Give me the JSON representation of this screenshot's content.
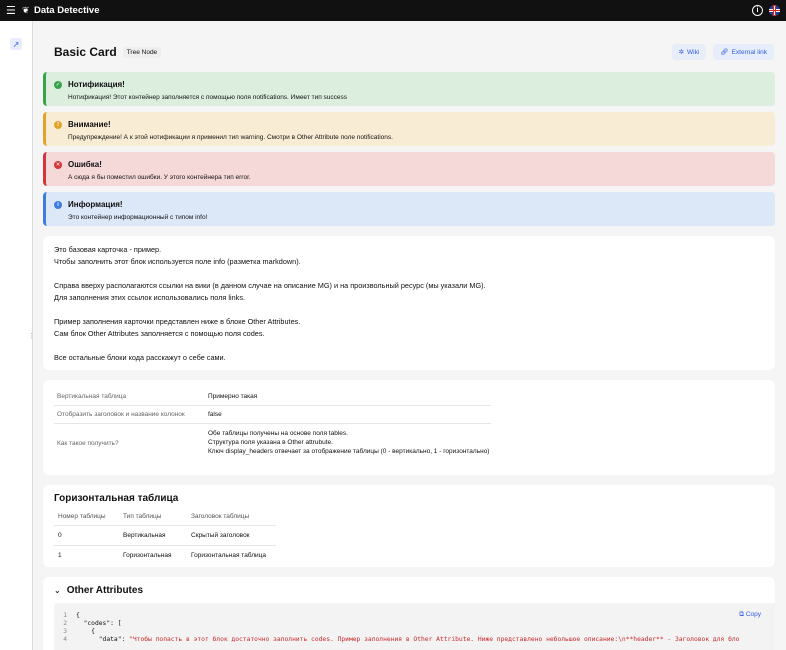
{
  "topbar": {
    "title": "Data Detective"
  },
  "header": {
    "title": "Basic Card",
    "tag": "Tree Node",
    "wiki_label": "Wiki",
    "external_label": "External link"
  },
  "alerts": [
    {
      "title": "Нотификация!",
      "body": "Нотификация! Этот контейнер заполняется с помощью поля notifications. Имеет тип success"
    },
    {
      "title": "Внимание!",
      "body": "Предупреждение! А к этой нотификации я применил тип warning. Смотри в Other Attribute поле notifications."
    },
    {
      "title": "Ошибка!",
      "body": "А сюда я бы поместил ошибки. У этого контейнера тип error."
    },
    {
      "title": "Информация!",
      "body": "Это контейнер информационный с типом info!"
    }
  ],
  "description": {
    "p1a": "Это базовая карточка - пример.",
    "p1b": "Чтобы заполнить этот блок используется поле info (разметка markdown).",
    "p2a": "Справа вверху располагаются ссылки на вики (в данном случае на описание MG) и на произвольный ресурс (мы указали MG).",
    "p2b": "Для заполнения этих ссылок использовались поля links.",
    "p3a": "Пример заполнения карточки представлен ниже в блоке Other Attributes.",
    "p3b": "Сам блок Other Attributes заполняется с помощью поля codes.",
    "p4": "Все остальные блоки кода расскажут о себе сами."
  },
  "vertical_table": {
    "rows": [
      {
        "key": "Вертикальная таблица",
        "value": "Примерно такая"
      },
      {
        "key": "Отобразить заголовок и название колонок",
        "value": "false"
      },
      {
        "key": "Как такое получить?",
        "lines": [
          "Обе таблицы получены на основе поля tables.",
          "Структура поля указана в Other attrubute.",
          "Ключ display_headers отвечает за отображение таблицы (0 - вертикально, 1 - горизонтально)"
        ]
      }
    ]
  },
  "horizontal_table": {
    "title": "Горизонтальная таблица",
    "headers": [
      "Номер таблицы",
      "Тип таблицы",
      "Заголовок таблицы"
    ],
    "rows": [
      [
        "0",
        "Вертикальная",
        "Скрытый заголовок"
      ],
      [
        "1",
        "Горизонтальная",
        "Горизонтальная таблица"
      ]
    ]
  },
  "other_attributes": {
    "title": "Other Attributes",
    "copy_label": "Copy",
    "code": {
      "n1": "1",
      "l1": "{",
      "n2": "2",
      "l2": "  \"codes\": [",
      "n3": "3",
      "l3": "    {",
      "n4": "4",
      "l4_key": "      \"data\": ",
      "l4_val": "\"Чтобы попасть в этот блок достаточно заполнить codes. Пример заполнения в Other Attribute. Ниже представлено небольшое описание:\\n**header** - Заголовок для бло"
    }
  }
}
